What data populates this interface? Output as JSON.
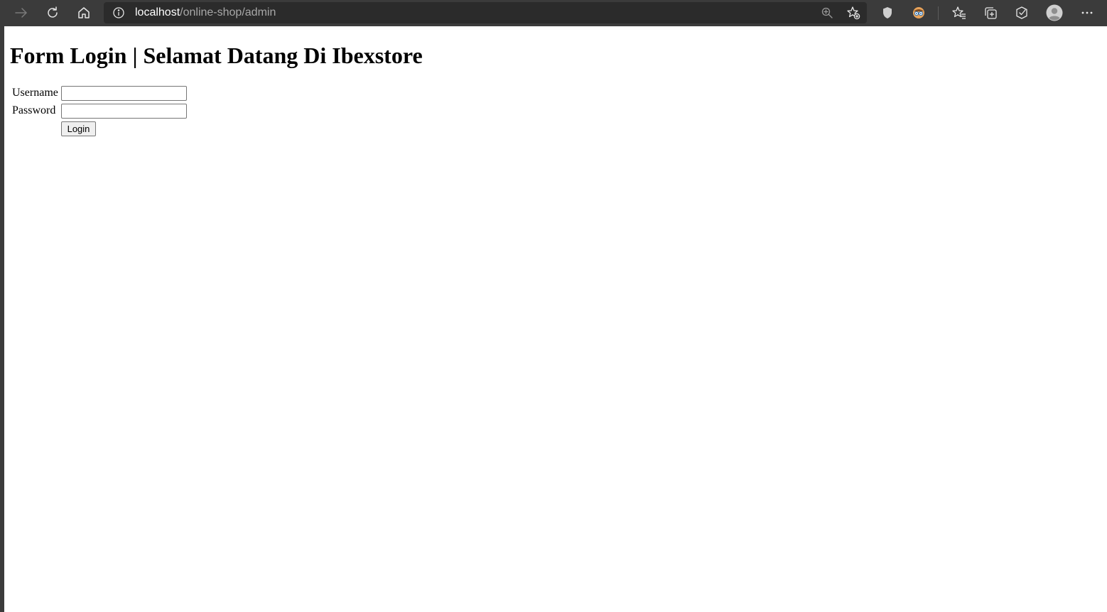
{
  "browser": {
    "url_host": "localhost",
    "url_path": "/online-shop/admin",
    "icons": {
      "forward": "arrow-right-icon",
      "reload": "reload-icon",
      "home": "home-icon",
      "site_info": "info-icon",
      "zoom": "zoom-icon",
      "add_favorite": "add-favorite-icon",
      "shield": "shield-icon",
      "extension": "extension-icon",
      "favorites": "favorites-icon",
      "collections": "collections-icon",
      "performance": "performance-icon",
      "profile": "profile-avatar-icon",
      "menu": "more-menu-icon"
    },
    "colors": {
      "toolbar": "#3b3b3b",
      "addressbar": "#2b2b2b"
    }
  },
  "page": {
    "title": "Form Login | Selamat Datang Di Ibexstore",
    "form": {
      "username_label": "Username",
      "username_value": "",
      "password_label": "Password",
      "password_value": "",
      "submit_label": "Login"
    }
  }
}
